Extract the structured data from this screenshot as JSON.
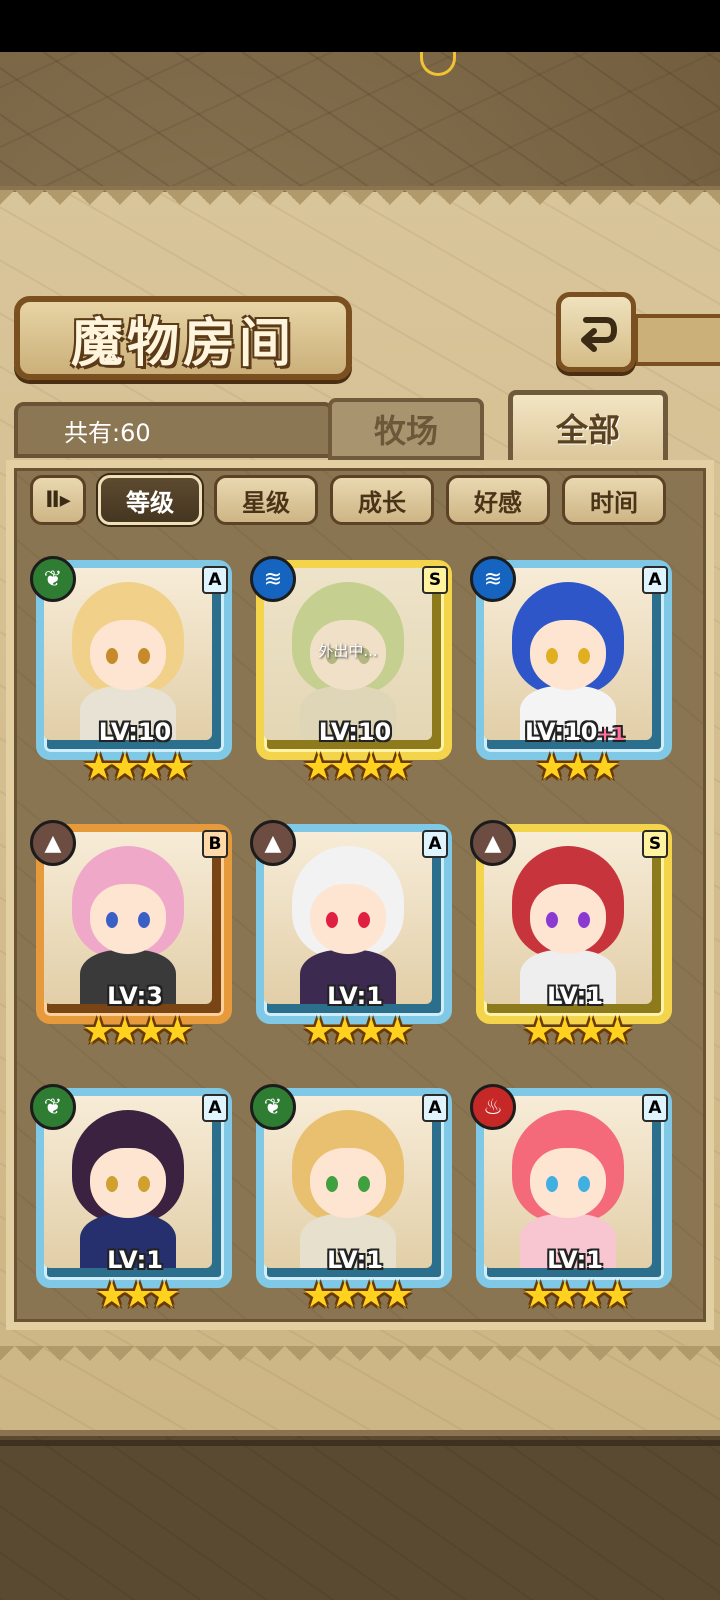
{
  "screen": {
    "title": "魔物房间",
    "count_label": "共有:60",
    "tabs": [
      {
        "label": "牧场",
        "active": false
      },
      {
        "label": "全部",
        "active": true
      }
    ],
    "sort": {
      "toggle_label": "Ⅱ▸",
      "buttons": [
        {
          "label": "等级",
          "active": true
        },
        {
          "label": "星级",
          "active": false
        },
        {
          "label": "成长",
          "active": false
        },
        {
          "label": "好感",
          "active": false
        },
        {
          "label": "时间",
          "active": false
        }
      ]
    },
    "back_icon": "back-arrow-icon"
  },
  "monsters": [
    {
      "element": "leaf",
      "element_glyph": "❦",
      "element_color": "#2e7d32",
      "rarity": "A",
      "level": "LV:10",
      "bonus": "",
      "stars": "★★★★",
      "away": false,
      "hair": "#f1d08a",
      "outfit": "#e8e2d4",
      "eyes": "#c58a2a"
    },
    {
      "element": "water",
      "element_glyph": "≋",
      "element_color": "#1565c0",
      "rarity": "S",
      "level": "LV:10",
      "bonus": "",
      "stars": "★★★★",
      "away": true,
      "away_text": "外出中...",
      "hair": "#9bbf5a",
      "outfit": "#d8ccb0",
      "eyes": "#7a8a3a"
    },
    {
      "element": "water",
      "element_glyph": "≋",
      "element_color": "#1565c0",
      "rarity": "A",
      "level": "LV:10",
      "bonus": "+1",
      "stars": "★★★",
      "away": false,
      "hair": "#2f56c8",
      "outfit": "#f4f4f4",
      "eyes": "#e0b020"
    },
    {
      "element": "earth",
      "element_glyph": "▲",
      "element_color": "#6d4c41",
      "rarity": "B",
      "level": "LV:3",
      "bonus": "",
      "stars": "★★★★",
      "away": false,
      "hair": "#f0a8c8",
      "outfit": "#3a3a3a",
      "eyes": "#3a60c8"
    },
    {
      "element": "earth",
      "element_glyph": "▲",
      "element_color": "#6d4c41",
      "rarity": "A",
      "level": "LV:1",
      "bonus": "",
      "stars": "★★★★",
      "away": false,
      "hair": "#f2f2f2",
      "outfit": "#3d2a50",
      "eyes": "#e02040"
    },
    {
      "element": "earth",
      "element_glyph": "▲",
      "element_color": "#6d4c41",
      "rarity": "S",
      "level": "LV:1",
      "bonus": "",
      "stars": "★★★★",
      "away": false,
      "hair": "#c8343c",
      "outfit": "#eeeeee",
      "eyes": "#8a3ad0"
    },
    {
      "element": "leaf",
      "element_glyph": "❦",
      "element_color": "#2e7d32",
      "rarity": "A",
      "level": "LV:1",
      "bonus": "",
      "stars": "★★★",
      "away": false,
      "hair": "#3a2240",
      "outfit": "#27306e",
      "eyes": "#d0a030"
    },
    {
      "element": "leaf",
      "element_glyph": "❦",
      "element_color": "#2e7d32",
      "rarity": "A",
      "level": "LV:1",
      "bonus": "",
      "stars": "★★★★",
      "away": false,
      "hair": "#e8c070",
      "outfit": "#e6e0cc",
      "eyes": "#40a040"
    },
    {
      "element": "fire",
      "element_glyph": "♨",
      "element_color": "#c62828",
      "rarity": "A",
      "level": "LV:1",
      "bonus": "",
      "stars": "★★★★",
      "away": false,
      "hair": "#f46a7a",
      "outfit": "#f8c6d0",
      "eyes": "#40b0e0"
    }
  ]
}
